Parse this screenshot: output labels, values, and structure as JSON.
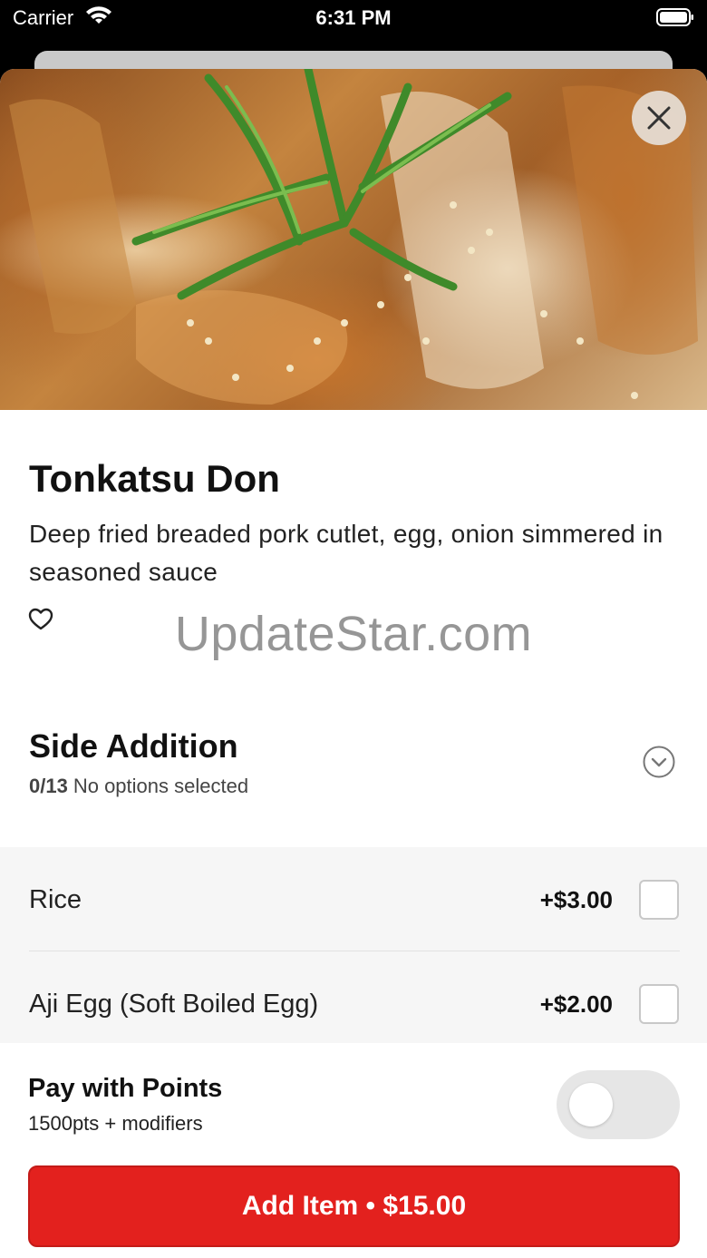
{
  "status_bar": {
    "carrier": "Carrier",
    "time": "6:31 PM"
  },
  "item": {
    "title": "Tonkatsu Don",
    "description": "Deep fried breaded pork cutlet, egg, onion simmered in seasoned sauce"
  },
  "watermark": "UpdateStar.com",
  "section": {
    "title": "Side Addition",
    "count": "0/13",
    "status": "No options selected"
  },
  "options": [
    {
      "name": "Rice",
      "price": "+$3.00"
    },
    {
      "name": "Aji Egg (Soft Boiled Egg)",
      "price": "+$2.00"
    }
  ],
  "points": {
    "title": "Pay with Points",
    "subtitle": "1500pts + modifiers",
    "enabled": false
  },
  "add_button": {
    "label": "Add Item • $15.00"
  },
  "colors": {
    "accent": "#e3211e",
    "toggle_off": "#e6e6e6"
  },
  "icons": [
    "wifi-icon",
    "battery-icon",
    "close-icon",
    "heart-icon",
    "chevron-down-icon"
  ]
}
